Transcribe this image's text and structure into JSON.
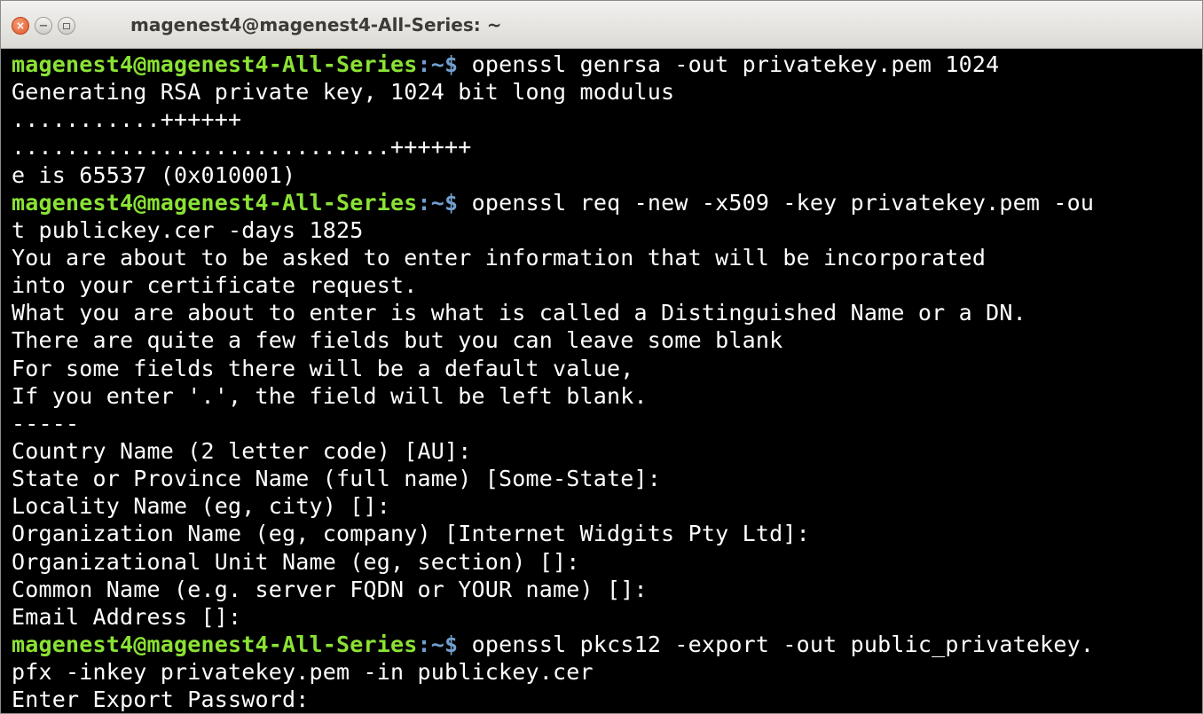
{
  "window": {
    "title": "magenest4@magenest4-All-Series: ~",
    "controls": {
      "close_icon": "×",
      "minimize_icon": "−"
    }
  },
  "terminal": {
    "user_host": "magenest4@magenest4-All-Series",
    "path_sep": ":~$",
    "lines": [
      {
        "type": "prompt",
        "cmd": " openssl genrsa -out privatekey.pem 1024"
      },
      {
        "type": "output",
        "text": "Generating RSA private key, 1024 bit long modulus"
      },
      {
        "type": "output",
        "text": "...........++++++"
      },
      {
        "type": "output",
        "text": "............................++++++"
      },
      {
        "type": "output",
        "text": "e is 65537 (0x010001)"
      },
      {
        "type": "prompt",
        "cmd": " openssl req -new -x509 -key privatekey.pem -ou"
      },
      {
        "type": "output",
        "text": "t publickey.cer -days 1825"
      },
      {
        "type": "output",
        "text": "You are about to be asked to enter information that will be incorporated"
      },
      {
        "type": "output",
        "text": "into your certificate request."
      },
      {
        "type": "output",
        "text": "What you are about to enter is what is called a Distinguished Name or a DN."
      },
      {
        "type": "output",
        "text": "There are quite a few fields but you can leave some blank"
      },
      {
        "type": "output",
        "text": "For some fields there will be a default value,"
      },
      {
        "type": "output",
        "text": "If you enter '.', the field will be left blank."
      },
      {
        "type": "output",
        "text": "-----"
      },
      {
        "type": "output",
        "text": "Country Name (2 letter code) [AU]:"
      },
      {
        "type": "output",
        "text": "State or Province Name (full name) [Some-State]:"
      },
      {
        "type": "output",
        "text": "Locality Name (eg, city) []:"
      },
      {
        "type": "output",
        "text": "Organization Name (eg, company) [Internet Widgits Pty Ltd]:"
      },
      {
        "type": "output",
        "text": "Organizational Unit Name (eg, section) []:"
      },
      {
        "type": "output",
        "text": "Common Name (e.g. server FQDN or YOUR name) []:"
      },
      {
        "type": "output",
        "text": "Email Address []:"
      },
      {
        "type": "prompt",
        "cmd": " openssl pkcs12 -export -out public_privatekey."
      },
      {
        "type": "output",
        "text": "pfx -inkey privatekey.pem -in publickey.cer"
      },
      {
        "type": "output",
        "text": "Enter Export Password:"
      }
    ]
  }
}
